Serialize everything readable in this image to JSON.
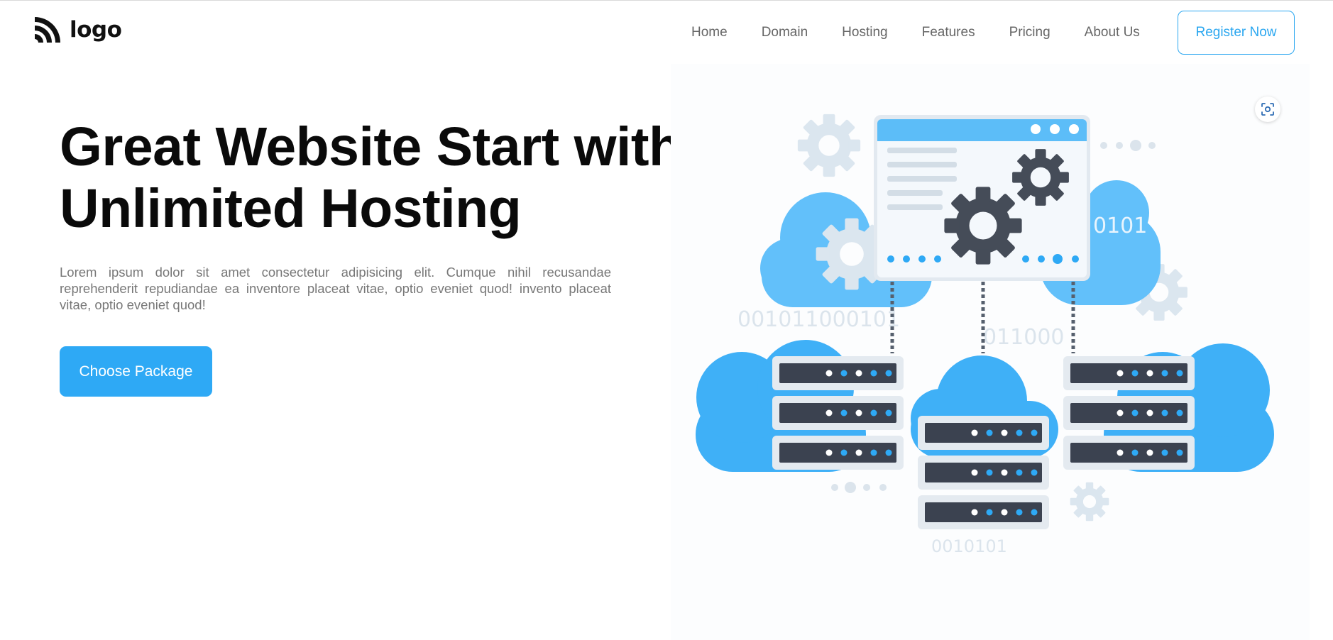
{
  "header": {
    "logo_text": "logo",
    "logo_icon": "rss-arc-icon",
    "nav": [
      {
        "label": "Home"
      },
      {
        "label": "Domain"
      },
      {
        "label": "Hosting"
      },
      {
        "label": "Features"
      },
      {
        "label": "Pricing"
      },
      {
        "label": "About Us"
      }
    ],
    "register_label": "Register Now"
  },
  "hero": {
    "title_line1": "Great Website Start with",
    "title_line2": "Unlimited Hosting",
    "description": "Lorem ipsum dolor sit amet consectetur adipisicing elit. Cumque nihil recusandae reprehenderit repudiandae ea inventore placeat vitae, optio eveniet quod! invento placeat vitae, optio eveniet quod!",
    "cta_label": "Choose Package"
  },
  "illustration": {
    "binary_1": "0101",
    "binary_2": "001011000101",
    "binary_3": "011000",
    "binary_4": "0010101",
    "scan_icon": "visual-search-icon"
  },
  "colors": {
    "accent": "#2ea9f5",
    "cloud": "#5cbdf8",
    "server_dark": "#3b4250",
    "gear_dark": "#454c58",
    "title_text": "#0a0a0a",
    "body_text": "#777777"
  }
}
